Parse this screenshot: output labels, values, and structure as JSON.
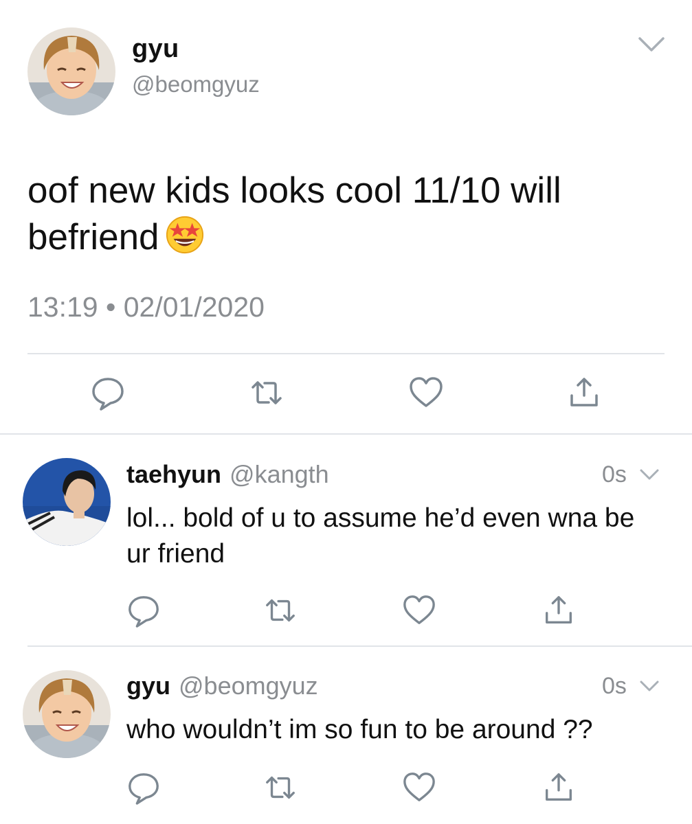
{
  "main_tweet": {
    "display_name": "gyu",
    "handle": "@beomgyuz",
    "text": "oof new kids looks cool 11/10 will befriend",
    "emoji": "star-struck-emoji",
    "timestamp": "13:19 • 02/01/2020"
  },
  "replies": [
    {
      "display_name": "taehyun",
      "handle": "@kangth",
      "time": "0s",
      "text": "lol... bold of u to assume he’d even wna be ur friend"
    },
    {
      "display_name": "gyu",
      "handle": "@beomgyuz",
      "time": "0s",
      "text": "who wouldn’t im so fun to be around ??"
    }
  ],
  "icons": {
    "reply": "reply-icon",
    "retweet": "retweet-icon",
    "like": "like-icon",
    "share": "share-icon",
    "menu": "chevron-down-icon"
  },
  "colors": {
    "icon_gray": "#7c8791",
    "text_gray": "#8a8d91",
    "divider": "#e1e4e8"
  }
}
